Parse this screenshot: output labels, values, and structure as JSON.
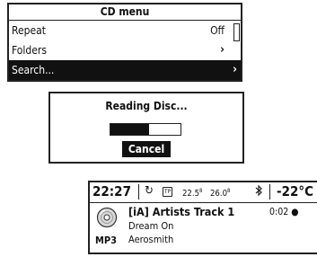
{
  "cd_menu": {
    "title": "CD menu",
    "items": [
      {
        "label": "Repeat",
        "value": "Off",
        "selected": false
      },
      {
        "label": "Folders",
        "value": "",
        "selected": false
      },
      {
        "label": "Search...",
        "value": "",
        "selected": true
      }
    ],
    "chevron": "›"
  },
  "reading_dialog": {
    "title": "Reading Disc...",
    "progress_fraction": 0.55,
    "cancel_label": "Cancel"
  },
  "now_playing": {
    "status": {
      "clock": "22:27",
      "tp_label": "TP",
      "freq_a": "22.5",
      "freq_a_sup": "8",
      "freq_b": "26.0",
      "freq_b_sup": "8",
      "temperature": "-22°C"
    },
    "format": "MP3",
    "track": "[iA] Artists Track 1",
    "time": "0:02",
    "album": "Dream On",
    "artist": "Aerosmith"
  },
  "icons": [
    "repeat-icon",
    "bluetooth-icon",
    "disc-icon",
    "chevron-right-icon"
  ]
}
